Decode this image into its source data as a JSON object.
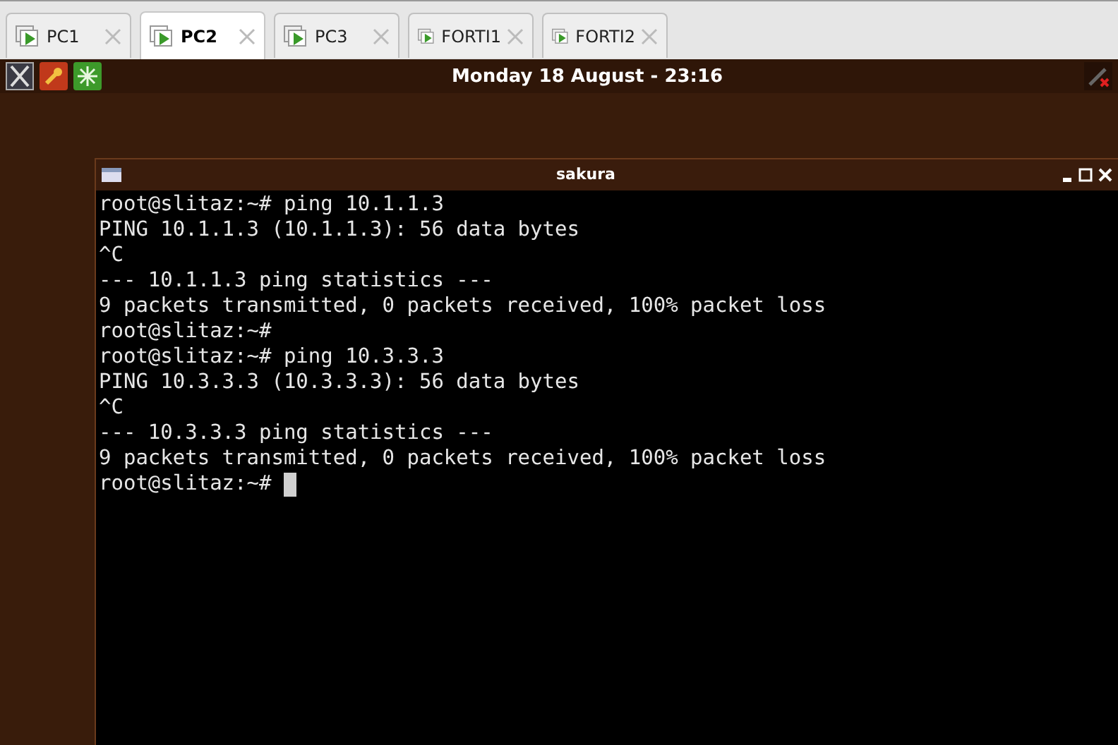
{
  "tabs": [
    {
      "label": "PC1",
      "selected": false
    },
    {
      "label": "PC2",
      "selected": true
    },
    {
      "label": "PC3",
      "selected": false
    },
    {
      "label": "FORTI1",
      "selected": false
    },
    {
      "label": "FORTI2",
      "selected": false
    }
  ],
  "panel": {
    "clock": "Monday 18 August - 23:16"
  },
  "terminal": {
    "title": "sakura",
    "lines": [
      "root@slitaz:~# ping 10.1.1.3",
      "PING 10.1.1.3 (10.1.1.3): 56 data bytes",
      "^C",
      "--- 10.1.1.3 ping statistics ---",
      "9 packets transmitted, 0 packets received, 100% packet loss",
      "root@slitaz:~#",
      "root@slitaz:~# ping 10.3.3.3",
      "PING 10.3.3.3 (10.3.3.3): 56 data bytes",
      "^C",
      "--- 10.3.3.3 ping statistics ---",
      "9 packets transmitted, 0 packets received, 100% packet loss"
    ],
    "prompt": "root@slitaz:~#"
  }
}
